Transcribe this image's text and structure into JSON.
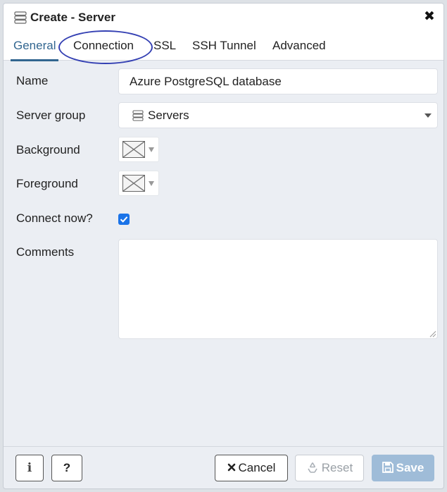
{
  "dialog": {
    "title": "Create - Server",
    "title_icon": "server-group-icon",
    "close_icon": "close-icon",
    "close_glyph": "✖"
  },
  "tabs": [
    {
      "label": "General",
      "active": true
    },
    {
      "label": "Connection",
      "active": false,
      "annotated": true
    },
    {
      "label": "SSL",
      "active": false
    },
    {
      "label": "SSH Tunnel",
      "active": false
    },
    {
      "label": "Advanced",
      "active": false
    }
  ],
  "form": {
    "name_label": "Name",
    "name_value": "Azure PostgreSQL database",
    "server_group_label": "Server group",
    "server_group_value": "Servers",
    "background_label": "Background",
    "foreground_label": "Foreground",
    "connect_now_label": "Connect now?",
    "connect_now_checked": true,
    "comments_label": "Comments",
    "comments_value": ""
  },
  "footer": {
    "info_glyph": "i",
    "help_glyph": "?",
    "cancel_label": "Cancel",
    "cancel_icon": "x-icon",
    "reset_label": "Reset",
    "reset_icon": "recycle-icon",
    "save_label": "Save",
    "save_icon": "floppy-disk-icon"
  },
  "colors": {
    "accent": "#326690",
    "annotation": "#3440b3",
    "checkbox": "#1a73e8",
    "save_button": "#9fbcd8"
  }
}
